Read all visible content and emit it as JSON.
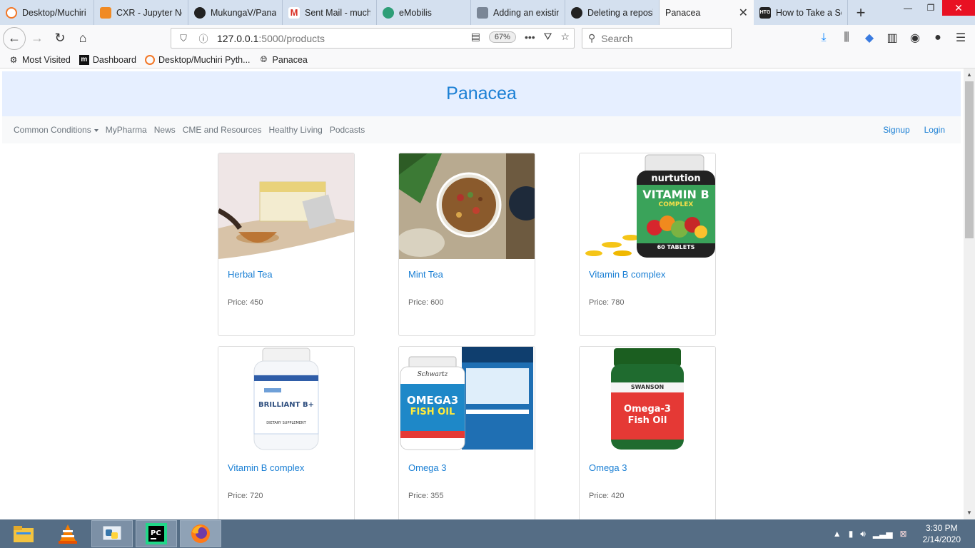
{
  "browser": {
    "tabs": [
      {
        "title": "Desktop/Muchiri",
        "icon": "jupyter-icon"
      },
      {
        "title": "CXR - Jupyter No",
        "icon": "notebook-icon"
      },
      {
        "title": "MukungaV/Pana",
        "icon": "github-icon"
      },
      {
        "title": "Sent Mail - much",
        "icon": "gmail-icon"
      },
      {
        "title": "eMobilis",
        "icon": "emobilis-icon"
      },
      {
        "title": "Adding an existin",
        "icon": "page-icon"
      },
      {
        "title": "Deleting a reposit",
        "icon": "github-icon"
      },
      {
        "title": "Panacea",
        "icon": "",
        "active": true
      },
      {
        "title": "How to Take a Sc",
        "icon": "htg-icon"
      }
    ],
    "url": {
      "host": "127.0.0.1",
      "rest": ":5000/products",
      "zoom": "67%"
    },
    "search_placeholder": "Search",
    "bookmarks": [
      {
        "label": "Most Visited",
        "icon": "gear-icon"
      },
      {
        "label": "Dashboard",
        "icon": "dashboard-icon"
      },
      {
        "label": "Desktop/Muchiri Pyth...",
        "icon": "jupyter-icon"
      },
      {
        "label": "Panacea",
        "icon": "globe-icon"
      }
    ]
  },
  "site": {
    "title": "Panacea",
    "nav": {
      "dropdown": "Common Conditions",
      "links": [
        "MyPharma",
        "News",
        "CME and Resources",
        "Healthy Living",
        "Podcasts"
      ],
      "right": [
        "Signup",
        "Login"
      ]
    },
    "price_prefix": "Price: ",
    "products": [
      {
        "name": "Herbal Tea",
        "price": "Price: 450",
        "image": "herbal-tea-image"
      },
      {
        "name": "Mint Tea",
        "price": "Price: 600",
        "image": "mint-tea-image"
      },
      {
        "name": "Vitamin B complex",
        "price": "Price: 780",
        "image": "vitamin-b-bottle-image"
      },
      {
        "name": "Vitamin B complex",
        "price": "Price: 720",
        "image": "brilliant-b-bottle-image"
      },
      {
        "name": "Omega 3",
        "price": "Price: 355",
        "image": "omega3-box-image"
      },
      {
        "name": "Omega 3",
        "price": "Price: 420",
        "image": "swanson-omega3-image"
      }
    ],
    "product_image_text": {
      "vitamin_brand": "nurtution",
      "vitamin_label": "VITAMIN B",
      "vitamin_sub": "COMPLEX",
      "vitamin_count": "60 TABLETS",
      "brilliant_label": "BRILLIANT B+",
      "brilliant_sub": "DIETARY SUPPLEMENT",
      "omega_brand": "Schwartz",
      "omega_label": "OMEGA3",
      "omega_sub": "FISH OIL",
      "swanson_brand": "SWANSON",
      "swanson_label": "Omega-3",
      "swanson_sub": "Fish Oil"
    }
  },
  "taskbar": {
    "apps": [
      "file-explorer-icon",
      "vlc-icon",
      "python-idle-icon",
      "pycharm-icon",
      "firefox-icon"
    ],
    "time": "3:30 PM",
    "date": "2/14/2020"
  },
  "colors": {
    "link": "#1a7fd4",
    "jumbotron": "#e6efff",
    "taskbar": "#556d85"
  }
}
